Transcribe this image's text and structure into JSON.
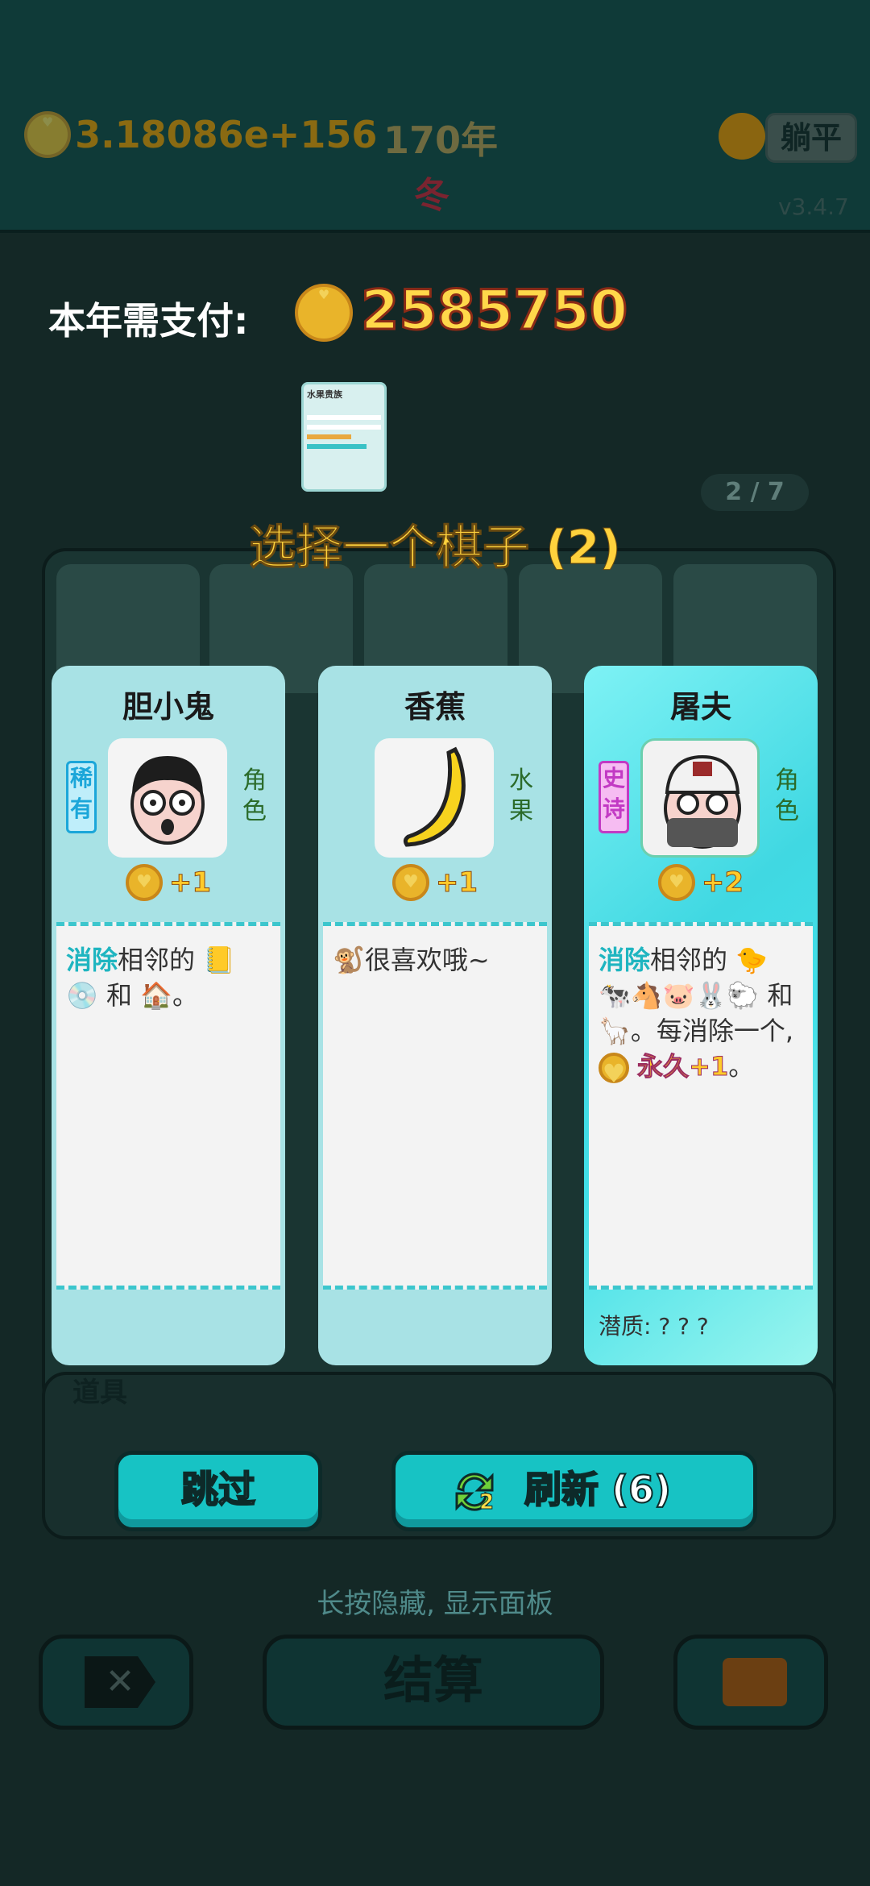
{
  "status": {
    "coins": "3.18086e+156",
    "year": "170年",
    "season": "冬",
    "lie_flat": "躺平",
    "version": "v3.4.7"
  },
  "payment": {
    "label": "本年需支付:",
    "amount": "2585750"
  },
  "mini_card": {
    "title": "水果贵族"
  },
  "page_indicator": "2 / 7",
  "select_title": "选择一个棋子 (2)",
  "cards": [
    {
      "name": "胆小鬼",
      "rarity": "稀有",
      "type": "角色",
      "value": "+1",
      "desc_kw": "消除",
      "desc_text": "相邻的",
      "desc_and": "和",
      "desc_end": "。"
    },
    {
      "name": "香蕉",
      "type": "水果",
      "value": "+1",
      "desc_text": "很喜欢哦~"
    },
    {
      "name": "屠夫",
      "rarity": "史诗",
      "type": "角色",
      "value": "+2",
      "desc_kw": "消除",
      "desc_text": "相邻的",
      "desc_and": "和",
      "desc_mid": "。每消除一个",
      "desc_comma": ",",
      "desc_perm": "永久+1",
      "desc_end": "。",
      "potential": "潜质: ? ? ?"
    }
  ],
  "buttons": {
    "skip": "跳过",
    "refresh": "刷新 (6)",
    "refresh_badge": "2"
  },
  "hint": "长按隐藏, 显示面板",
  "bottom": {
    "settle": "结算",
    "props_label": "道具"
  },
  "icons": [
    "coin-icon",
    "refresh-icon",
    "close-icon",
    "briefcase-icon",
    "banana-icon",
    "nerd-face-icon",
    "butcher-face-icon",
    "monkey-icon",
    "book-icon",
    "cd-icon",
    "house-icon",
    "chick-icon"
  ],
  "colors": {
    "accent": "#17c3c4",
    "gold": "#ffd84a",
    "rare": "#1ba6d9",
    "epic": "#c23ac4"
  }
}
